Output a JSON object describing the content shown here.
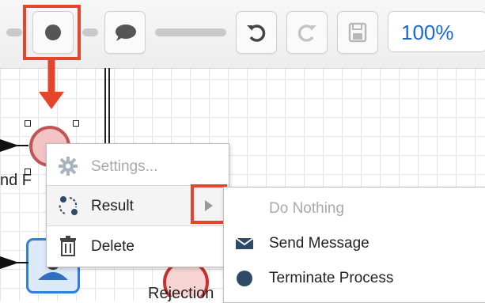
{
  "toolbar": {
    "zoom_label": "100%"
  },
  "canvas": {
    "node_label_partial": "nd F",
    "rejection_label": "Rejection"
  },
  "context_menu": {
    "items": [
      {
        "label": "Settings...",
        "icon": "gear-icon",
        "enabled": false
      },
      {
        "label": "Result",
        "icon": "result-icon",
        "enabled": true,
        "has_submenu": true
      },
      {
        "label": "Delete",
        "icon": "trash-icon",
        "enabled": true
      }
    ]
  },
  "submenu": {
    "items": [
      {
        "label": "Do Nothing",
        "icon": "",
        "enabled": false
      },
      {
        "label": "Send Message",
        "icon": "envelope-icon",
        "enabled": true
      },
      {
        "label": "Terminate Process",
        "icon": "dot-icon",
        "enabled": true
      }
    ]
  },
  "colors": {
    "highlight": "#e5452b",
    "accent_blue": "#1769d6",
    "icon_dark": "#2f4a66"
  }
}
